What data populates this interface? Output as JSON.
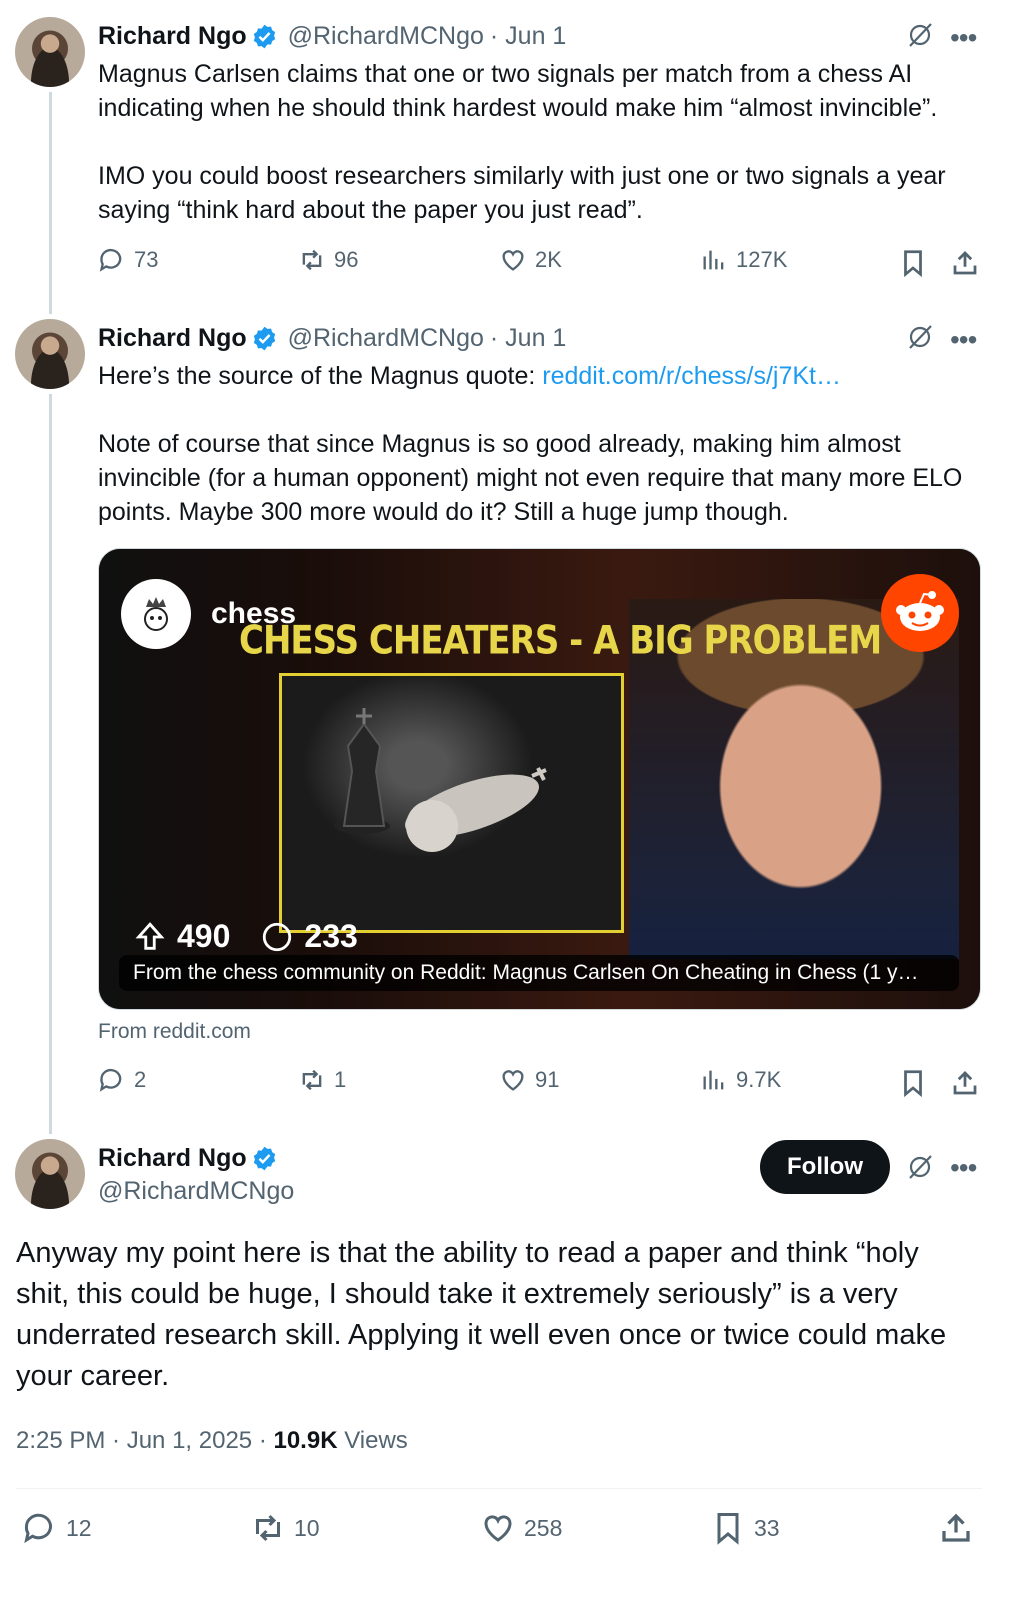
{
  "tweets": [
    {
      "author": "Richard Ngo",
      "handle": "@RichardMCNgo",
      "date_sep": "· Jun 1",
      "text": "Magnus Carlsen claims that one or two signals per match from a chess AI indicating when he should think hardest would make him “almost invincible”.\n\nIMO you could boost researchers similarly with just one or two signals a year saying “think hard about the paper you just read”.",
      "stats": {
        "replies": "73",
        "reposts": "96",
        "likes": "2K",
        "views": "127K"
      }
    },
    {
      "author": "Richard Ngo",
      "handle": "@RichardMCNgo",
      "date_sep": "· Jun 1",
      "text_prefix": "Here’s the source of the Magnus quote: ",
      "link_text": "reddit.com/r/chess/s/j7Kt…",
      "text_rest": "Note of course that since Magnus is so good already, making him almost invincible (for a human opponent) might not even require that many more ELO points. Maybe 300 more would do it? Still a huge jump though.",
      "card": {
        "subreddit": "chess",
        "headline": "CHESS CHEATERS - A BIG PROBLEM",
        "upvotes": "490",
        "comments": "233",
        "caption": "From the chess community on Reddit: Magnus Carlsen On Cheating in Chess (1 y…",
        "source": "From reddit.com"
      },
      "stats": {
        "replies": "2",
        "reposts": "1",
        "likes": "91",
        "views": "9.7K"
      }
    }
  ],
  "main_tweet": {
    "author": "Richard Ngo",
    "handle": "@RichardMCNgo",
    "follow_label": "Follow",
    "text": "Anyway my point here is that the ability to read a paper and think “holy shit, this could be huge, I should take it extremely seriously” is a very underrated research skill. Applying it well even once or twice could make your career.",
    "timestamp": "2:25 PM · Jun 1, 2025 · ",
    "views_count": "10.9K",
    "views_label": " Views",
    "stats": {
      "replies": "12",
      "reposts": "10",
      "likes": "258",
      "bookmarks": "33"
    }
  },
  "icons": {
    "verified": "verified-badge-icon",
    "grok": "grok-icon",
    "more": "more-icon",
    "reply": "reply-icon",
    "repost": "repost-icon",
    "like": "like-icon",
    "views": "views-icon",
    "bookmark": "bookmark-icon",
    "share": "share-icon"
  },
  "colors": {
    "accent": "#1d9bf0",
    "text": "#0f1419",
    "muted": "#536471",
    "headline_yellow": "#e8d64a",
    "reddit_orange": "#ff4500"
  }
}
